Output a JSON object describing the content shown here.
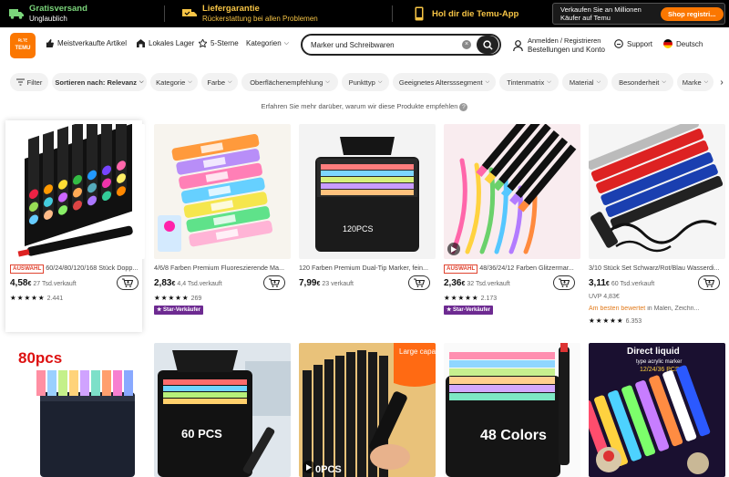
{
  "promo": {
    "shipping_title": "Gratisversand",
    "shipping_sub": "Unglaublich",
    "delivery_title": "Liefergarantie",
    "delivery_sub": "Rückerstattung bei allen Problemen",
    "app_label": "Hol dir die Temu-App",
    "seller_text": "Verkaufen Sie an Millionen Käufer auf Temu",
    "seller_button": "Shop registri..."
  },
  "header": {
    "logo_top": "ᴿᴸᵀᴱ",
    "logo_text": "TEMU",
    "nav": [
      "Meistverkaufte Artikel",
      "Lokales Lager",
      "5-Sterne",
      "Kategorien"
    ],
    "search_value": "Marker und Schreibwaren",
    "account_line1": "Anmelden / Registrieren",
    "account_line2": "Bestellungen und Konto",
    "support": "Support",
    "language": "Deutsch"
  },
  "filters": {
    "filter_label": "Filter",
    "sort_label": "Sortieren nach: Relevanz",
    "chips": [
      "Kategorie",
      "Farbe",
      "Oberflächenempfehlung",
      "Punkttyp",
      "Geeignetes Altersssegment",
      "Tintenmatrix",
      "Material",
      "Besonderheit",
      "Marke"
    ]
  },
  "info_text": "Erfahren Sie mehr darüber, warum wir diese Produkte empfehlen",
  "products": [
    {
      "badge": "AUSWAHL",
      "title": "60/24/80/120/168 Stück Dopp...",
      "price_int": "4,58",
      "sold": "27 Tsd.verkauft",
      "stars": "★★★★★",
      "count": "2.441",
      "star_seller": ""
    },
    {
      "badge": "",
      "title": "4/6/8 Farben Premium Fluoreszierende Ma...",
      "price_int": "2,83",
      "sold": "4,4 Tsd.verkauft",
      "stars": "★★★★★",
      "count": "269",
      "star_seller": "Star-Verkäufer"
    },
    {
      "badge": "",
      "title": "120 Farben Premium Dual-Tip Marker, fein...",
      "price_int": "7,99",
      "sold": "23 verkauft",
      "stars": "",
      "count": "",
      "star_seller": ""
    },
    {
      "badge": "AUSWAHL",
      "title": "48/36/24/12 Farben Glitzermar...",
      "price_int": "2,36",
      "sold": "32 Tsd.verkauft",
      "stars": "★★★★★",
      "count": "2.173",
      "star_seller": "Star-Verkäufer"
    },
    {
      "badge": "",
      "title": "3/10 Stück Set Schwarz/Rot/Blau Wasserdi...",
      "price_int": "3,11",
      "sold": "60 Tsd.verkauft",
      "uvp": "UVP 4,83€",
      "best_hl": "Am besten bewertet",
      "best_rest": " in Malen, Zeichn...",
      "stars": "★★★★★",
      "count": "6.353",
      "star_seller": ""
    }
  ],
  "image_labels": {
    "p3_box": "120PCS",
    "r2_big": "80pcs",
    "r2_60": "60 PCS",
    "r2_large": "Large capacity",
    "r2_pcs": "0PCS",
    "r2_48": "48 Colors",
    "r2_direct": "Direct liquid",
    "r2_direct_sub": "type acrylic marker",
    "r2_direct_sub2": "12/24/36 PCS"
  },
  "currency": "€",
  "colors": {
    "accent": "#fb7701",
    "star_seller": "#6d2a91",
    "auswahl": "#e0432f"
  }
}
